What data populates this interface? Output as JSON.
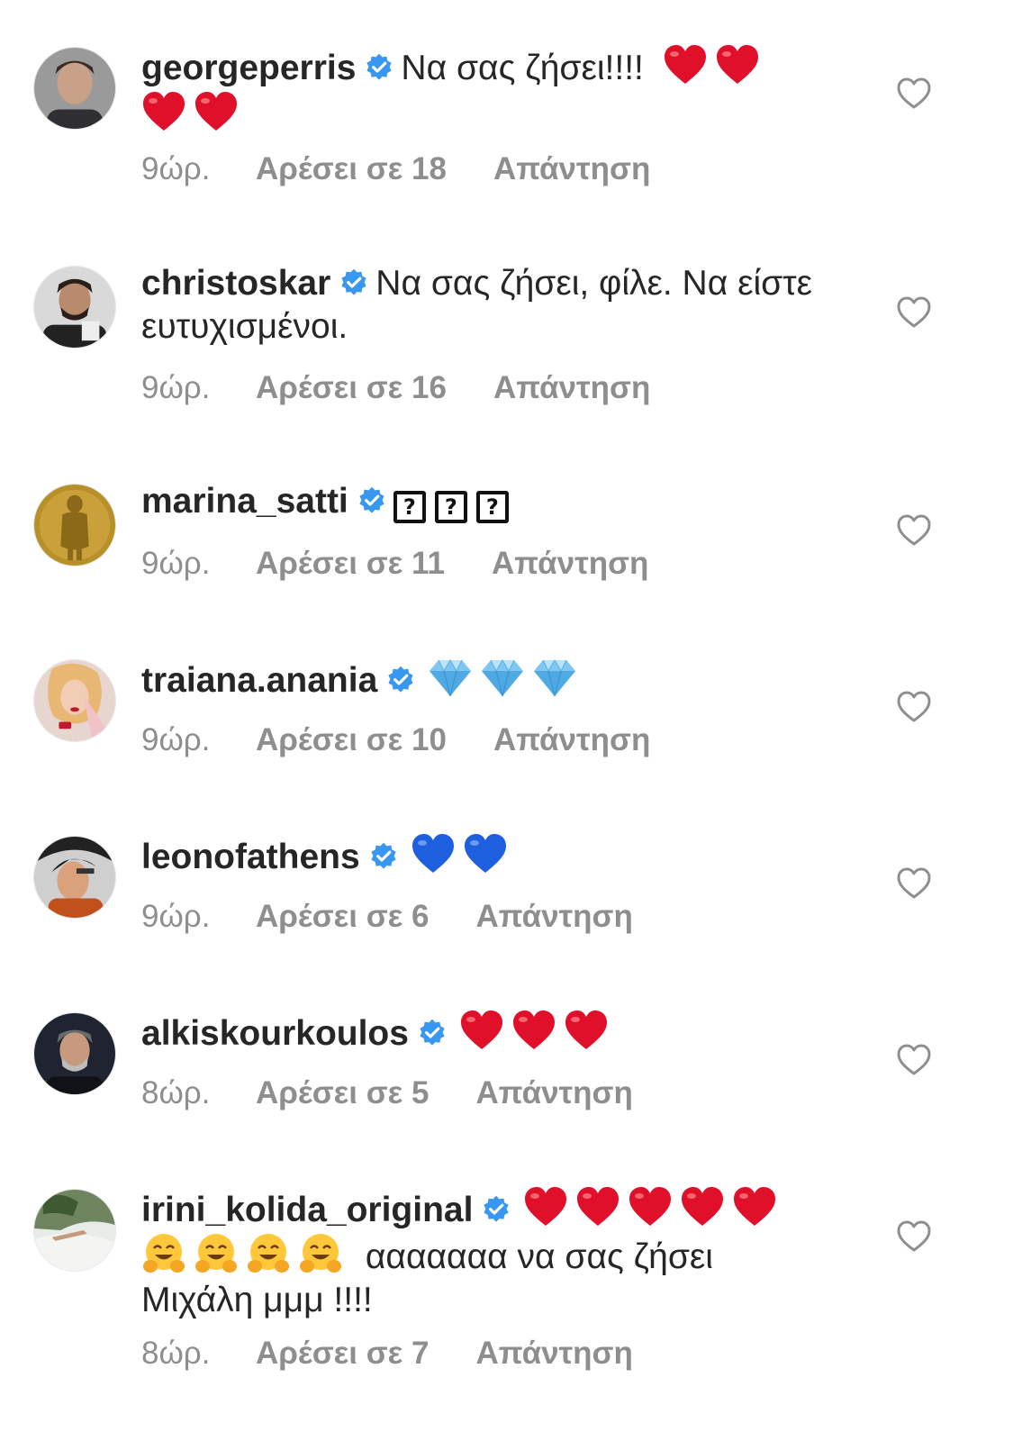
{
  "colors": {
    "username": "#262626",
    "meta": "#8e8e8e",
    "verified": "#3897f0",
    "heart_red": "#e0102b",
    "heart_blue": "#1e5fe0"
  },
  "comments": [
    {
      "username": "georgeperris",
      "text": "Να σας ζήσει!!!!",
      "text_after": "",
      "emoji": [
        "red-heart",
        "red-heart",
        "red-heart",
        "red-heart"
      ],
      "time": "9ώρ.",
      "likes": "Αρέσει σε 18",
      "reply": "Απάντηση"
    },
    {
      "username": "christoskar",
      "text": "Να σας ζήσει, φίλε. Να είστε ευτυχισμένοι.",
      "text_after": "",
      "emoji": [],
      "time": "9ώρ.",
      "likes": "Αρέσει σε 16",
      "reply": "Απάντηση"
    },
    {
      "username": "marina_satti",
      "text": "",
      "text_after": "",
      "emoji": [
        "?",
        "?",
        "?"
      ],
      "time": "9ώρ.",
      "likes": "Αρέσει σε 11",
      "reply": "Απάντηση"
    },
    {
      "username": "traiana.anania",
      "text": "",
      "text_after": "",
      "emoji": [
        "gem",
        "gem",
        "gem"
      ],
      "time": "9ώρ.",
      "likes": "Αρέσει σε 10",
      "reply": "Απάντηση"
    },
    {
      "username": "leonofathens",
      "text": "",
      "text_after": "",
      "emoji": [
        "blue-heart",
        "blue-heart"
      ],
      "time": "9ώρ.",
      "likes": "Αρέσει σε 6",
      "reply": "Απάντηση"
    },
    {
      "username": "alkiskourkoulos",
      "text": "",
      "text_after": "",
      "emoji": [
        "red-heart",
        "red-heart",
        "red-heart"
      ],
      "time": "8ώρ.",
      "likes": "Αρέσει σε 5",
      "reply": "Απάντηση"
    },
    {
      "username": "irini_kolida_original",
      "text": "",
      "text_after": "ααααααα να σας ζήσει Μιχάλη μμμ !!!!",
      "emoji": [
        "red-heart",
        "red-heart",
        "red-heart",
        "red-heart",
        "red-heart",
        "hugging-face",
        "hugging-face",
        "hugging-face",
        "hugging-face"
      ],
      "time": "8ώρ.",
      "likes": "Αρέσει σε 7",
      "reply": "Απάντηση"
    }
  ]
}
